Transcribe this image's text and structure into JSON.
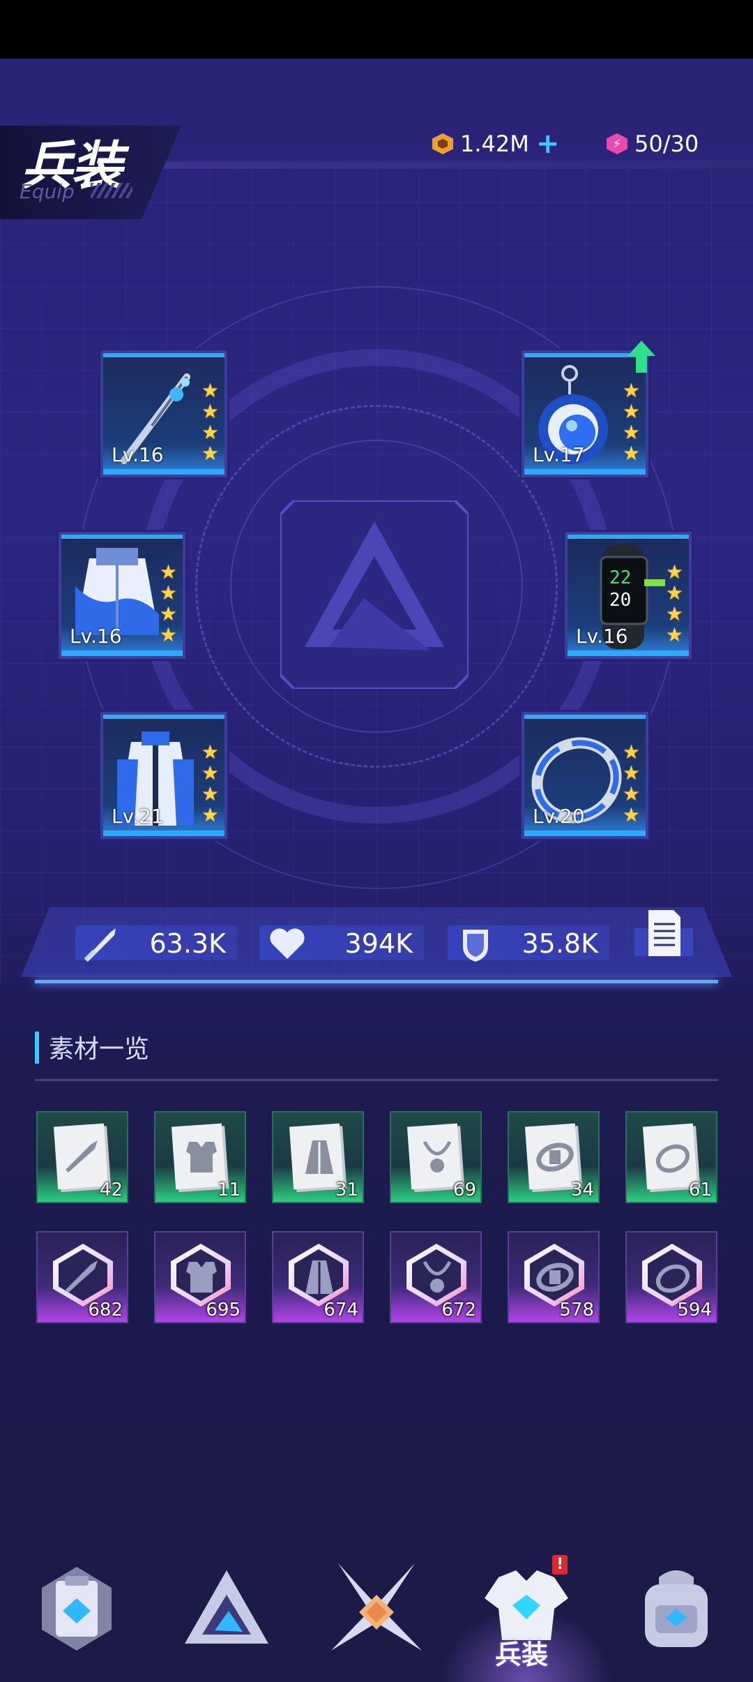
{
  "header": {
    "title_cn": "兵装",
    "subtitle_en": "Equip"
  },
  "currencies": {
    "coins": "1.42M",
    "energy": "50/30"
  },
  "equipment_slots": [
    {
      "slot": "weapon",
      "level": "Lv.16",
      "stars": 4,
      "icon": "dagger-icon"
    },
    {
      "slot": "pendant",
      "level": "Lv.17",
      "stars": 4,
      "icon": "pendant-icon",
      "upgradable": true
    },
    {
      "slot": "jacket",
      "level": "Lv.16",
      "stars": 4,
      "icon": "jacket-icon"
    },
    {
      "slot": "wristband",
      "level": "Lv.16",
      "stars": 4,
      "icon": "smartband-icon"
    },
    {
      "slot": "coat",
      "level": "Lv.21",
      "stars": 4,
      "icon": "coat-icon"
    },
    {
      "slot": "ring",
      "level": "Lv.20",
      "stars": 4,
      "icon": "ring-icon"
    }
  ],
  "band_screen_text": "22 20",
  "stats": {
    "attack": "63.3K",
    "hp": "394K",
    "defense": "35.8K"
  },
  "materials": {
    "section_title": "素材一览",
    "green_row": [
      {
        "item": "sword-blueprint-icon",
        "count": "42"
      },
      {
        "item": "armor-blueprint-icon",
        "count": "11"
      },
      {
        "item": "coat-blueprint-icon",
        "count": "31"
      },
      {
        "item": "necklace-blueprint-icon",
        "count": "69"
      },
      {
        "item": "band-blueprint-icon",
        "count": "34"
      },
      {
        "item": "ring-blueprint-icon",
        "count": "61"
      }
    ],
    "purple_row": [
      {
        "item": "sword-core-icon",
        "count": "682"
      },
      {
        "item": "armor-core-icon",
        "count": "695"
      },
      {
        "item": "coat-core-icon",
        "count": "674"
      },
      {
        "item": "necklace-core-icon",
        "count": "672"
      },
      {
        "item": "band-core-icon",
        "count": "578"
      },
      {
        "item": "ring-core-icon",
        "count": "594"
      }
    ]
  },
  "nav": {
    "active_label": "兵装",
    "badge": "!",
    "items": [
      "clipboard-icon",
      "triangle-icon",
      "crossed-swords-icon",
      "armor-icon",
      "backpack-icon"
    ]
  },
  "colors": {
    "accent": "#3fc8ff",
    "star": "#ffd34a",
    "green_rarity": "#2ccf7f",
    "purple_rarity": "#b144e8",
    "upgrade_arrow": "#2fe08a",
    "badge": "#e0262f"
  }
}
